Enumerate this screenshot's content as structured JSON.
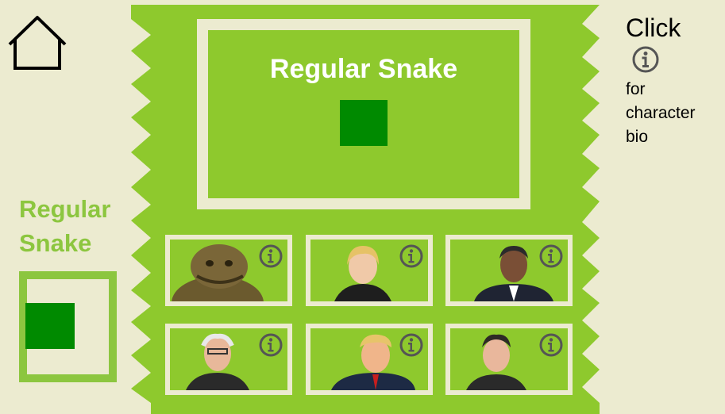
{
  "selected_character": {
    "name": "Regular Snake",
    "color": "#008a00"
  },
  "preview": {
    "title": "Regular Snake",
    "swatch_color": "#008a00"
  },
  "help": {
    "click_label": "Click",
    "line1": "for",
    "line2": "character",
    "line3": "bio",
    "icon": "info-icon"
  },
  "characters": [
    {
      "id": "char-1",
      "icon": "info-icon"
    },
    {
      "id": "char-2",
      "icon": "info-icon"
    },
    {
      "id": "char-3",
      "icon": "info-icon"
    },
    {
      "id": "char-4",
      "icon": "info-icon"
    },
    {
      "id": "char-5",
      "icon": "info-icon"
    },
    {
      "id": "char-6",
      "icon": "info-icon"
    }
  ],
  "colors": {
    "background": "#ecebd0",
    "board_green": "#8ec92d",
    "accent_green": "#8cc63f",
    "swatch_green": "#008a00"
  }
}
